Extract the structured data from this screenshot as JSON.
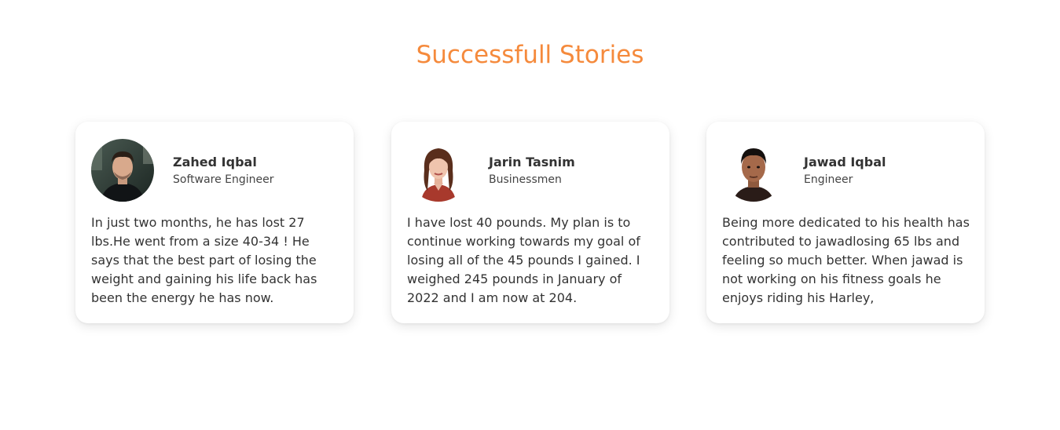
{
  "section": {
    "title": "Successfull Stories"
  },
  "cards": [
    {
      "name": "Zahed Iqbal",
      "role": "Software Engineer",
      "story": "In just two months, he has lost 27 lbs.He went from a size 40-34 ! He says that the best part of losing the weight and gaining his life back has been the energy he has now."
    },
    {
      "name": "Jarin Tasnim",
      "role": "Businessmen",
      "story": "I have lost 40 pounds. My plan is to continue working towards my goal of losing all of the 45 pounds I gained. I weighed 245 pounds in January of 2022 and I am now at 204."
    },
    {
      "name": "Jawad Iqbal",
      "role": "Engineer",
      "story": "Being more dedicated to his health has contributed to jawadlosing 65 lbs and feeling so much better. When jawad is not working on his fitness goals he enjoys riding his Harley,"
    }
  ],
  "colors": {
    "accent": "#f58a3c",
    "text": "#333333",
    "card_bg": "#ffffff"
  }
}
